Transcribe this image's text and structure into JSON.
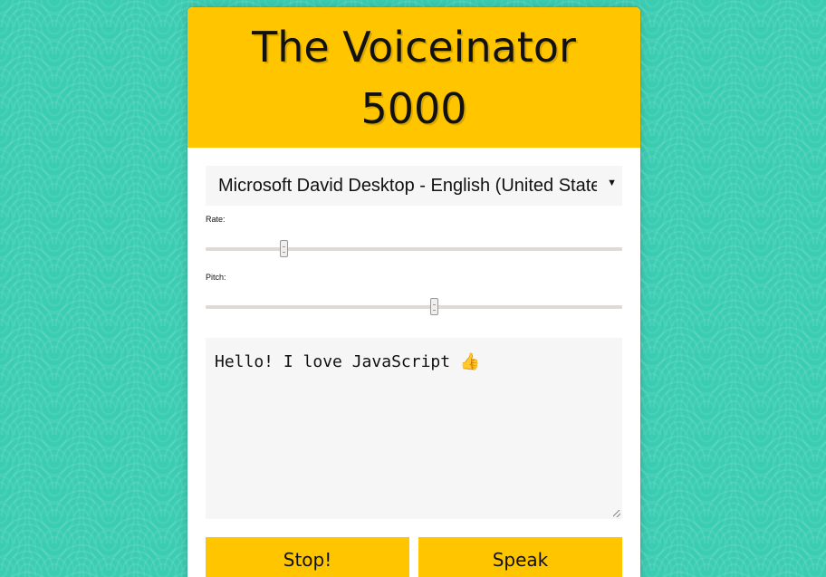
{
  "app": {
    "title": "The Voiceinator 5000"
  },
  "voice_select": {
    "selected": "Microsoft David Desktop - English (United States)",
    "arrow_icon": "dropdown-triangle-icon"
  },
  "rate": {
    "label": "Rate:",
    "value_fraction": 0.19
  },
  "pitch": {
    "label": "Pitch:",
    "value_fraction": 0.55
  },
  "message": {
    "text": "Hello! I love JavaScript 👍"
  },
  "buttons": {
    "stop_label": "Stop!",
    "speak_label": "Speak"
  },
  "colors": {
    "accent": "#ffc600",
    "background": "#3bcdb2"
  }
}
